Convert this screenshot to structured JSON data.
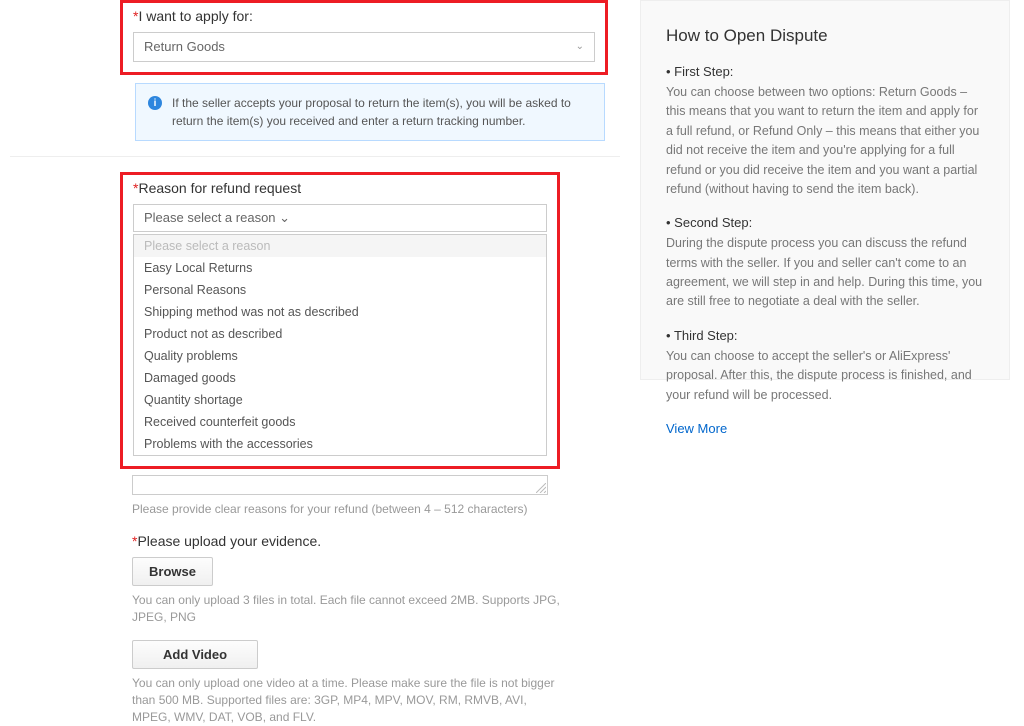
{
  "apply": {
    "label": "I want to apply for:",
    "selected": "Return Goods"
  },
  "info_banner": "If the seller accepts your proposal to return the item(s), you will be asked to return the item(s) you received and enter a return tracking number.",
  "reason": {
    "label": "Reason for refund request",
    "placeholder": "Please select a reason",
    "options": [
      "Please select a reason",
      "Easy Local Returns",
      "Personal Reasons",
      "Shipping method was not as described",
      "Product not as described",
      "Quality problems",
      "Damaged goods",
      "Quantity shortage",
      "Received counterfeit goods",
      "Problems with the accessories"
    ]
  },
  "reason_helper": "Please provide clear reasons for your refund (between 4 – 512 characters)",
  "evidence": {
    "label": "Please upload your evidence.",
    "browse": "Browse",
    "helper": "You can only upload 3 files in total. Each file cannot exceed 2MB. Supports JPG, JPEG, PNG"
  },
  "video": {
    "button": "Add Video",
    "helper": "You can only upload one video at a time. Please make sure the file is not bigger than 500 MB. Supported files are: 3GP, MP4, MPV, MOV, RM, RMVB, AVI, MPEG, WMV, DAT, VOB, and FLV."
  },
  "right": {
    "title": "How to Open Dispute",
    "step1_label": "First Step:",
    "step1_text": "You can choose between two options: Return Goods – this means that you want to return the item and apply for a full refund, or Refund Only – this means that either you did not receive the item and you're applying for a full refund or you did receive the item and you want a partial refund (without having to send the item back).",
    "step2_label": "Second Step:",
    "step2_text": "During the dispute process you can discuss the refund terms with the seller. If you and seller can't come to an agreement, we will step in and help. During this time, you are still free to negotiate a deal with the seller.",
    "step3_label": "Third Step:",
    "step3_text": "You can choose to accept the seller's or AliExpress' proposal. After this, the dispute process is finished, and your refund will be processed.",
    "view_more": "View More"
  }
}
